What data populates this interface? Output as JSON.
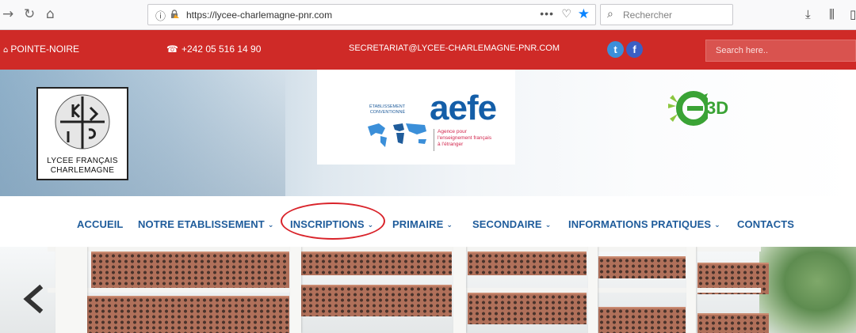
{
  "browser": {
    "url": "https://lycee-charlemagne-pnr.com",
    "search_placeholder": "Rechercher",
    "menu_dots": "•••"
  },
  "topbar": {
    "location": "POINTE-NOIRE",
    "phone": "+242 05 516 14 90",
    "email": "SECRETARIAT@LYCEE-CHARLEMAGNE-PNR.COM",
    "search_placeholder": "Search here..",
    "social": [
      "twitter-icon",
      "facebook-icon"
    ],
    "twitter_glyph": "t",
    "facebook_glyph": "f"
  },
  "header": {
    "school_logo_line1": "LYCEE FRANÇAIS",
    "school_logo_line2": "CHARLEMAGNE",
    "aefe_tag_line1": "ÉTABLISSEMENT",
    "aefe_tag_line2": "CONVENTIONNÉ",
    "aefe_word": "aefe",
    "aefe_agence_1": "Agence pour",
    "aefe_agence_2": "l'enseignement français",
    "aefe_agence_3": "à l'étranger",
    "e3d_label": "3D"
  },
  "nav": {
    "items": [
      {
        "label": "ACCUEIL",
        "dropdown": false
      },
      {
        "label": "NOTRE ETABLISSEMENT",
        "dropdown": true
      },
      {
        "label": "INSCRIPTIONS",
        "dropdown": true
      },
      {
        "label": "PRIMAIRE",
        "dropdown": true
      },
      {
        "label": "SECONDAIRE",
        "dropdown": true
      },
      {
        "label": "INFORMATIONS PRATIQUES",
        "dropdown": true
      },
      {
        "label": "CONTACTS",
        "dropdown": false
      }
    ],
    "chevron": "⌄"
  },
  "colors": {
    "topbar": "#cf2a27",
    "nav_text": "#1f5c9b",
    "annotation": "#d9232a"
  }
}
